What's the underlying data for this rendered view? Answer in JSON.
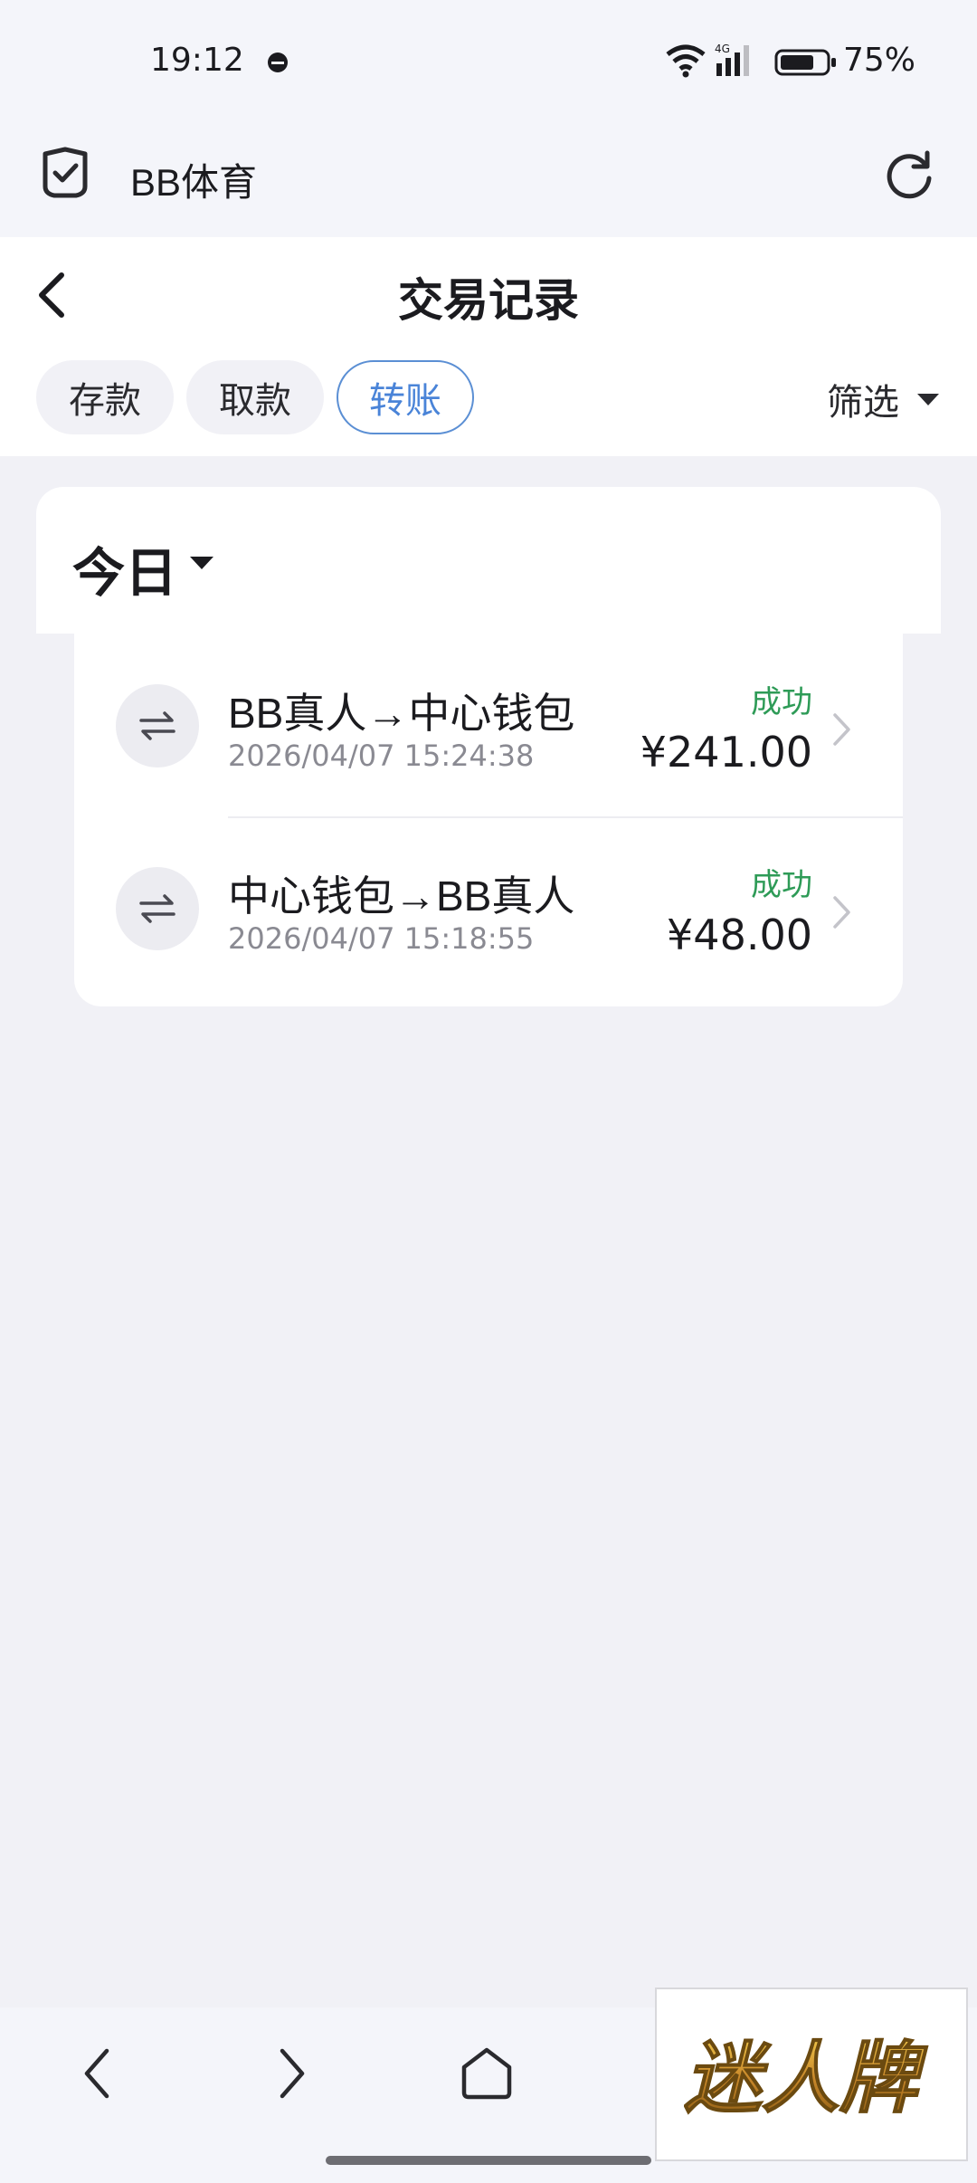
{
  "status_bar": {
    "time": "19:12",
    "network": "4G",
    "battery_percent": "75%",
    "battery_level": 0.75
  },
  "browser": {
    "site_name": "BB体育"
  },
  "header": {
    "title": "交易记录",
    "tabs": [
      {
        "label": "存款",
        "active": false
      },
      {
        "label": "取款",
        "active": false
      },
      {
        "label": "转账",
        "active": true
      }
    ],
    "filter_label": "筛选"
  },
  "section": {
    "day_label": "今日"
  },
  "transactions": [
    {
      "title": "BB真人→中心钱包",
      "time": "2026/04/07 15:24:38",
      "status": "成功",
      "amount": "¥241.00"
    },
    {
      "title": "中心钱包→BB真人",
      "time": "2026/04/07 15:18:55",
      "status": "成功",
      "amount": "¥48.00"
    }
  ],
  "watermark": {
    "text": "迷人牌"
  },
  "colors": {
    "accent": "#4a84d8",
    "success": "#2e9b57",
    "background": "#f1f1f6"
  }
}
